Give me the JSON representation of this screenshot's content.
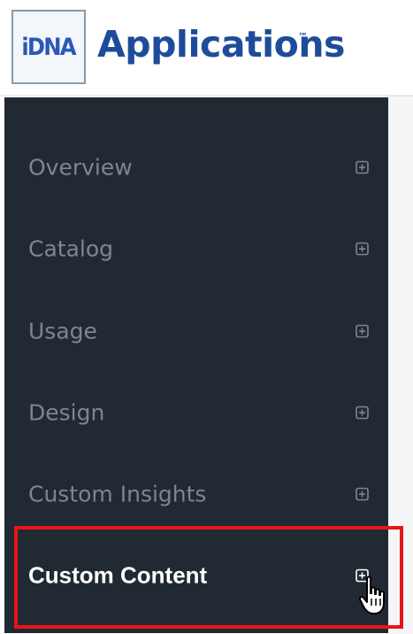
{
  "header": {
    "logo_text": "iDNA",
    "app_title": "Applications",
    "trademark": "™"
  },
  "sidebar": {
    "items": [
      {
        "label": "Overview",
        "icon": "expand-plus-icon",
        "active": false
      },
      {
        "label": "Catalog",
        "icon": "expand-plus-icon",
        "active": false
      },
      {
        "label": "Usage",
        "icon": "expand-plus-icon",
        "active": false
      },
      {
        "label": "Design",
        "icon": "expand-plus-icon",
        "active": false
      },
      {
        "label": "Custom Insights",
        "icon": "expand-plus-icon",
        "active": false
      },
      {
        "label": "Custom Content",
        "icon": "expand-plus-icon",
        "active": true
      }
    ]
  },
  "colors": {
    "sidebar_bg": "#212932",
    "item_text": "#7c8691",
    "active_text": "#ffffff",
    "brand_blue": "#1e4c9a",
    "highlight": "#e8141b"
  },
  "cursor": "hand-pointer-icon"
}
